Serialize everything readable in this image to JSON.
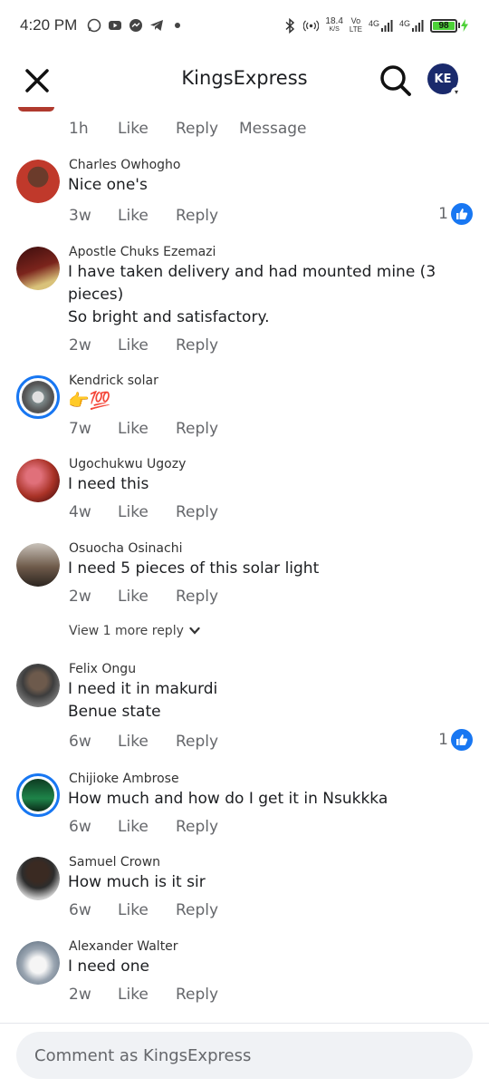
{
  "status_bar": {
    "time": "4:20 PM",
    "net_speed": "18.4",
    "net_unit": "K/S",
    "volte_top": "Vo",
    "volte_bottom": "LTE",
    "signal1": "4G",
    "signal2": "4G",
    "battery": "98"
  },
  "header": {
    "title": "KingsExpress",
    "avatar_initials": "KE"
  },
  "cut_comment": {
    "age": "1h",
    "like": "Like",
    "reply": "Reply",
    "message": "Message"
  },
  "comments": [
    {
      "name": "Charles Owhogho",
      "text": "Nice one's",
      "age": "3w",
      "like": "Like",
      "reply": "Reply",
      "reactions": "1",
      "avatar_color": "#c0392b"
    },
    {
      "name": "Apostle Chuks Ezemazi",
      "text": "I have taken delivery and had mounted mine (3 pieces)",
      "text2": "So bright and satisfactory.",
      "age": "2w",
      "like": "Like",
      "reply": "Reply",
      "avatar_color": "#7b241c"
    },
    {
      "name": "Kendrick solar",
      "text": "👉💯",
      "age": "7w",
      "like": "Like",
      "reply": "Reply",
      "avatar_color": "#7f8c8d"
    },
    {
      "name": "Ugochukwu Ugozy",
      "text": "I need this",
      "age": "4w",
      "like": "Like",
      "reply": "Reply",
      "avatar_color": "#a93226"
    },
    {
      "name": "Osuocha Osinachi",
      "text": "I need 5 pieces of this solar light",
      "age": "2w",
      "like": "Like",
      "reply": "Reply",
      "avatar_color": "#6e5a4a"
    },
    {
      "name": "Felix Ongu",
      "text": "I need it in makurdi",
      "text2": "Benue state",
      "age": "6w",
      "like": "Like",
      "reply": "Reply",
      "reactions": "1",
      "avatar_color": "#3d3d3d"
    },
    {
      "name": "Chijioke Ambrose",
      "text": "How much and how do I get it in Nsukkka",
      "age": "6w",
      "like": "Like",
      "reply": "Reply",
      "avatar_color": "#1e8449"
    },
    {
      "name": "Samuel Crown",
      "text": "How much is it sir",
      "age": "6w",
      "like": "Like",
      "reply": "Reply",
      "avatar_color": "#2c2c2c"
    },
    {
      "name": "Alexander Walter",
      "text": "I need one",
      "age": "2w",
      "like": "Like",
      "reply": "Reply",
      "avatar_color": "#9aa5b1"
    }
  ],
  "view_more": "View 1 more reply",
  "composer": {
    "placeholder": "Comment as KingsExpress"
  }
}
